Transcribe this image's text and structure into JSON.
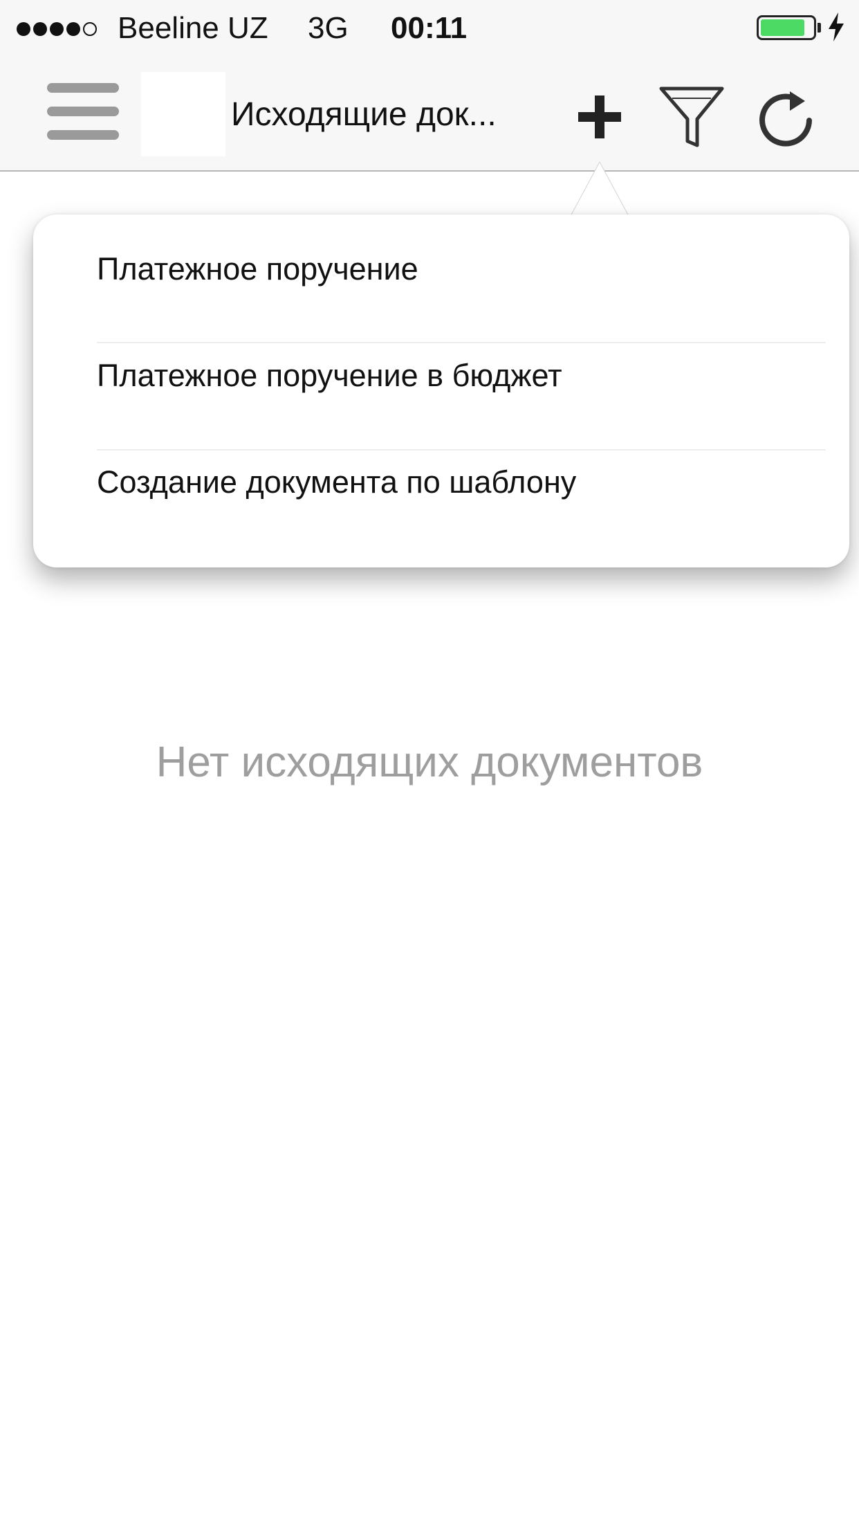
{
  "status_bar": {
    "signal_strength": 4,
    "signal_max": 5,
    "carrier": "Beeline UZ",
    "network": "3G",
    "time": "00:11",
    "battery_level": 0.85,
    "battery_color": "#4cd964",
    "charging_icon": "bolt-icon"
  },
  "nav_bar": {
    "menu_icon": "hamburger-menu-icon",
    "title": "Исходящие док...",
    "actions": [
      "plus-icon",
      "filter-icon",
      "refresh-icon"
    ]
  },
  "popover": {
    "items": [
      {
        "label": "Платежное поручение"
      },
      {
        "label": "Платежное поручение в бюджет"
      },
      {
        "label": "Создание документа по шаблону"
      }
    ]
  },
  "empty_state": {
    "message": "Нет исходящих документов"
  }
}
